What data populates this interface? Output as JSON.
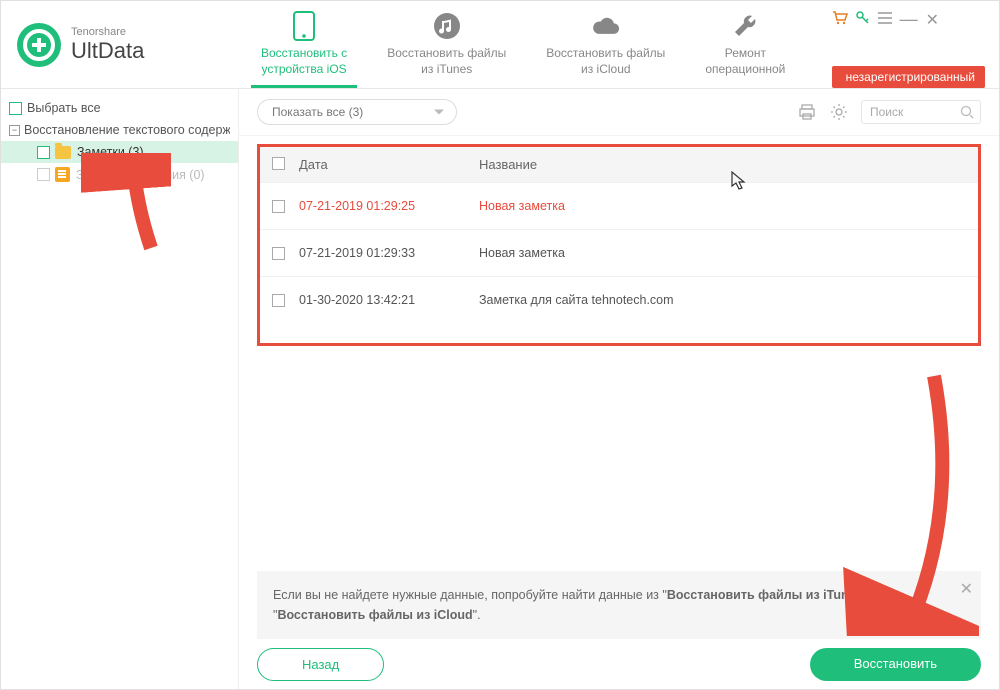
{
  "brand": {
    "company": "Tenorshare",
    "product": "UltData"
  },
  "tabs": [
    {
      "label": "Восстановить с\nустройства iOS",
      "icon": "phone"
    },
    {
      "label": "Восстановить файлы\nиз iTunes",
      "icon": "music"
    },
    {
      "label": "Восстановить файлы\nиз iCloud",
      "icon": "cloud"
    },
    {
      "label": "Ремонт\nоперационной",
      "icon": "wrench"
    }
  ],
  "badge_unregistered": "незарегистрированный",
  "sidebar": {
    "select_all": "Выбрать все",
    "group": "Восстановление текстового содержимо",
    "notes": "Заметки (3)",
    "attachments": "Заметки Вложения (0)"
  },
  "toolbar": {
    "dropdown": "Показать все  (3)",
    "search_placeholder": "Поиск"
  },
  "table": {
    "head_date": "Дата",
    "head_title": "Название",
    "rows": [
      {
        "date": "07-21-2019 01:29:25",
        "title": "Новая заметка",
        "deleted": true
      },
      {
        "date": "07-21-2019 01:29:33",
        "title": "Новая заметка",
        "deleted": false
      },
      {
        "date": "01-30-2020 13:42:21",
        "title": "Заметка для сайта tehnotech.com",
        "deleted": false
      }
    ]
  },
  "hint": {
    "prefix": "Если вы не найдете нужные данные, попробуйте найти данные из \"",
    "link1": "Восстановить файлы из iTunes",
    "mid": "\" или \"",
    "link2": "Восстановить файлы из iCloud",
    "suffix": "\"."
  },
  "buttons": {
    "back": "Назад",
    "recover": "Восстановить"
  }
}
